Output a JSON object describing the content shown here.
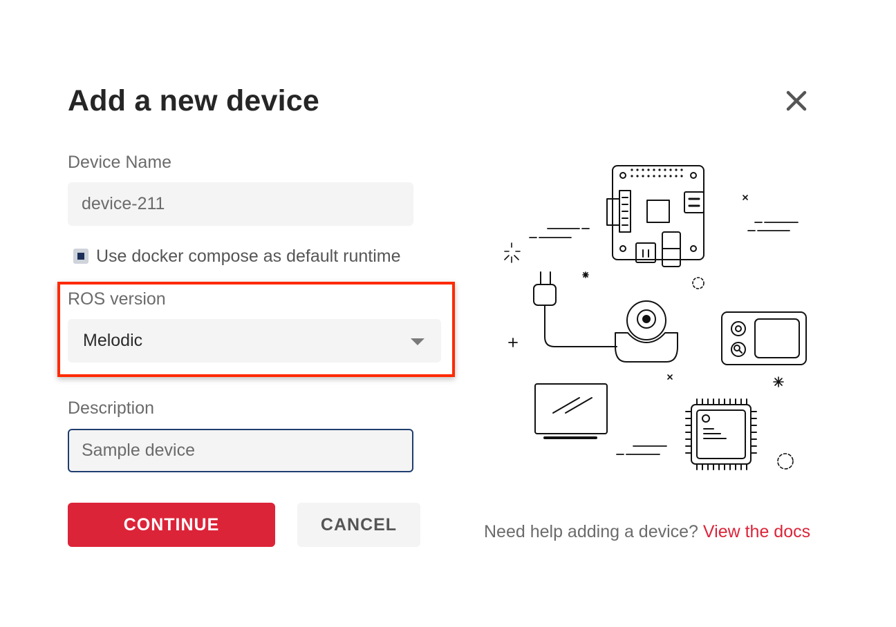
{
  "dialog": {
    "title": "Add a new device",
    "close_icon": "close-icon"
  },
  "form": {
    "device_name": {
      "label": "Device Name",
      "value": "device-211"
    },
    "docker_compose": {
      "label": "Use docker compose as default runtime",
      "checked": true
    },
    "ros_version": {
      "label": "ROS version",
      "value": "Melodic"
    },
    "description": {
      "label": "Description",
      "value": "Sample device"
    }
  },
  "actions": {
    "continue_label": "CONTINUE",
    "cancel_label": "CANCEL"
  },
  "help": {
    "text": "Need help adding a device?",
    "link": "View the docs"
  },
  "colors": {
    "accent": "#dc2439",
    "highlight": "#ff2a00",
    "focus_border": "#1f3d6e"
  }
}
